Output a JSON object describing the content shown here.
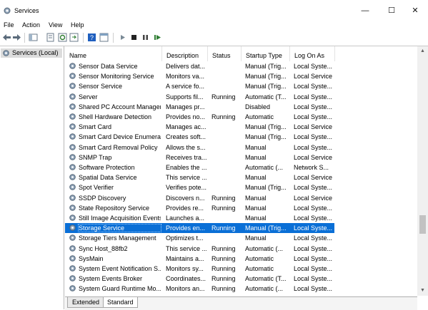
{
  "window": {
    "title": "Services",
    "minimize_glyph": "—",
    "maximize_glyph": "☐",
    "close_glyph": "✕"
  },
  "menu": [
    "File",
    "Action",
    "View",
    "Help"
  ],
  "toolbar": {
    "icons": [
      "back-icon",
      "forward-icon",
      "show-tree-icon",
      "properties-icon",
      "refresh-icon",
      "export-list-icon",
      "help-icon",
      "console-icon",
      "start-service-icon",
      "stop-service-icon",
      "pause-service-icon",
      "restart-service-icon"
    ],
    "colors": {
      "arrow": "#2e7d32",
      "stop": "#222222",
      "help": "#1f5fbf"
    }
  },
  "tree": {
    "selected_label": "Services (Local)"
  },
  "columns": {
    "name": "Name",
    "description": "Description",
    "status": "Status",
    "startup": "Startup Type",
    "logon": "Log On As"
  },
  "sort_indicator": "^",
  "services": [
    {
      "name": "Sensor Data Service",
      "description": "Delivers dat...",
      "status": "",
      "startup": "Manual (Trig...",
      "logon": "Local Syste..."
    },
    {
      "name": "Sensor Monitoring Service",
      "description": "Monitors va...",
      "status": "",
      "startup": "Manual (Trig...",
      "logon": "Local Service"
    },
    {
      "name": "Sensor Service",
      "description": "A service fo...",
      "status": "",
      "startup": "Manual (Trig...",
      "logon": "Local Syste..."
    },
    {
      "name": "Server",
      "description": "Supports fil...",
      "status": "Running",
      "startup": "Automatic (T...",
      "logon": "Local Syste..."
    },
    {
      "name": "Shared PC Account Manager",
      "description": "Manages pr...",
      "status": "",
      "startup": "Disabled",
      "logon": "Local Syste..."
    },
    {
      "name": "Shell Hardware Detection",
      "description": "Provides no...",
      "status": "Running",
      "startup": "Automatic",
      "logon": "Local Syste..."
    },
    {
      "name": "Smart Card",
      "description": "Manages ac...",
      "status": "",
      "startup": "Manual (Trig...",
      "logon": "Local Service"
    },
    {
      "name": "Smart Card Device Enumera...",
      "description": "Creates soft...",
      "status": "",
      "startup": "Manual (Trig...",
      "logon": "Local Syste..."
    },
    {
      "name": "Smart Card Removal Policy",
      "description": "Allows the s...",
      "status": "",
      "startup": "Manual",
      "logon": "Local Syste..."
    },
    {
      "name": "SNMP Trap",
      "description": "Receives tra...",
      "status": "",
      "startup": "Manual",
      "logon": "Local Service"
    },
    {
      "name": "Software Protection",
      "description": "Enables the ...",
      "status": "",
      "startup": "Automatic (...",
      "logon": "Network S..."
    },
    {
      "name": "Spatial Data Service",
      "description": "This service ...",
      "status": "",
      "startup": "Manual",
      "logon": "Local Service"
    },
    {
      "name": "Spot Verifier",
      "description": "Verifies pote...",
      "status": "",
      "startup": "Manual (Trig...",
      "logon": "Local Syste..."
    },
    {
      "name": "SSDP Discovery",
      "description": "Discovers n...",
      "status": "Running",
      "startup": "Manual",
      "logon": "Local Service"
    },
    {
      "name": "State Repository Service",
      "description": "Provides re...",
      "status": "Running",
      "startup": "Manual",
      "logon": "Local Syste..."
    },
    {
      "name": "Still Image Acquisition Events",
      "description": "Launches a...",
      "status": "",
      "startup": "Manual",
      "logon": "Local Syste..."
    },
    {
      "name": "Storage Service",
      "description": "Provides en...",
      "status": "Running",
      "startup": "Manual (Trig...",
      "logon": "Local Syste...",
      "selected": true
    },
    {
      "name": "Storage Tiers Management",
      "description": "Optimizes t...",
      "status": "",
      "startup": "Manual",
      "logon": "Local Syste..."
    },
    {
      "name": "Sync Host_88fb2",
      "description": "This service ...",
      "status": "Running",
      "startup": "Automatic (...",
      "logon": "Local Syste..."
    },
    {
      "name": "SysMain",
      "description": "Maintains a...",
      "status": "Running",
      "startup": "Automatic",
      "logon": "Local Syste..."
    },
    {
      "name": "System Event Notification S...",
      "description": "Monitors sy...",
      "status": "Running",
      "startup": "Automatic",
      "logon": "Local Syste..."
    },
    {
      "name": "System Events Broker",
      "description": "Coordinates...",
      "status": "Running",
      "startup": "Automatic (T...",
      "logon": "Local Syste..."
    },
    {
      "name": "System Guard Runtime Mo...",
      "description": "Monitors an...",
      "status": "Running",
      "startup": "Automatic (...",
      "logon": "Local Syste..."
    }
  ],
  "tabs": [
    "Extended",
    "Standard"
  ],
  "colors": {
    "selection": "#0a6fd6",
    "gear": "#6b7f96"
  }
}
